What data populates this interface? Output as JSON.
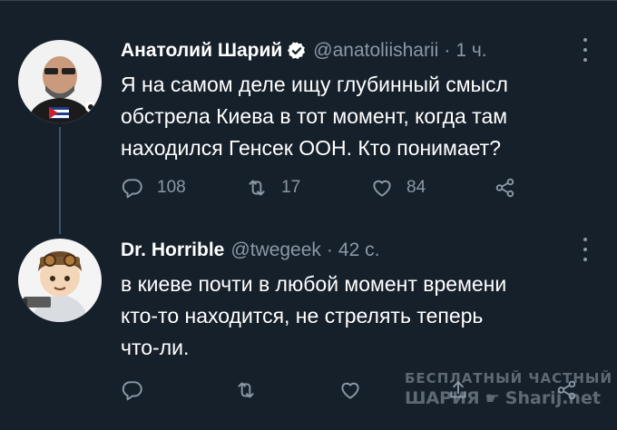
{
  "colors": {
    "background": "#15202b",
    "text_primary": "#ffffff",
    "text_secondary": "#8b98a5",
    "verified": "#ffffff",
    "thread_line": "#3d5466"
  },
  "tweets": [
    {
      "author_name": "Анатолий Шарий",
      "verified": true,
      "handle": "@anatoliisharii",
      "separator": "·",
      "time": "1 ч.",
      "text": "Я на самом деле ищу глубинный смысл обстрела Киева в тот момент, когда там находился Генсек ООН. Кто понимает?",
      "text_lines": [
        "Я на самом деле ищу глубинный смысл",
        "обстрела Киева в тот момент, когда там",
        "находился Генсек ООН. Кто понимает?"
      ],
      "reply_count": "108",
      "retweet_count": "17",
      "like_count": "84",
      "icons": [
        "reply-icon",
        "retweet-icon",
        "like-icon",
        "share-icon",
        "more-icon"
      ]
    },
    {
      "author_name": "Dr. Horrible",
      "verified": false,
      "handle": "@twegeek",
      "separator": "·",
      "time": "42 с.",
      "text": "в киеве почти в любой момент времени кто-то находится, не стрелять теперь что-ли.",
      "text_lines": [
        "в киеве почти в любой момент времени",
        "кто-то находится, не стрелять теперь",
        "что-ли."
      ],
      "reply_count": "",
      "retweet_count": "",
      "like_count": "",
      "icons": [
        "reply-icon",
        "retweet-icon",
        "like-icon",
        "share-icon",
        "more-icon"
      ]
    }
  ],
  "watermark": {
    "line1": "БЕСПЛАТНЫЙ ЧАСТНЫЙ",
    "line2_left": "ШАРИЯ",
    "line2_right": "Sharij.net"
  }
}
